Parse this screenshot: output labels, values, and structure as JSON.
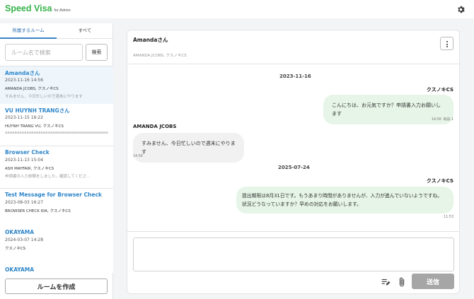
{
  "app": {
    "name": "Speed Visa",
    "subtitle": "for Admin"
  },
  "tabs": [
    {
      "label": "所属するルーム",
      "active": true
    },
    {
      "label": "すべて",
      "active": false
    }
  ],
  "search": {
    "placeholder": "ルーム名で検索",
    "value": "",
    "button_label": "検索"
  },
  "rooms": [
    {
      "title": "Amandaさん",
      "date": "2023-11-16 14:56",
      "members": "AMANDA JCOBS, クスノキCS",
      "preview": "すみません、今日忙しいので週末にやります"
    },
    {
      "title": "VU HUYNH TRANGさん",
      "date": "2023-11-15 16:22",
      "members": "HUYNH TRANG VU, クスノキCS",
      "preview": "aaaaaaaaaaaaaaaaaaaaaaaaaaaaaaaaaaaaaaaaaaaaaaaaaaaaa"
    },
    {
      "title": "Browser Check",
      "date": "2023-11-13 15:04",
      "members": "ASH MAYFAIR, クスノキCS",
      "preview": "申請書の入力依頼をしました。確認してくださ..."
    },
    {
      "title": "Test Message for Browser Check",
      "date": "2023-08-03 16:27",
      "members": "BROWSER CHECK IDA, クスノキCS",
      "preview": ""
    },
    {
      "title": "OKAYAMA",
      "date": "2024-03-07 14:28",
      "members": "クスノキCS",
      "preview": ""
    },
    {
      "title": "OKAYAMA",
      "date": "",
      "members": "",
      "preview": ""
    }
  ],
  "create_room_label": "ルームを作成",
  "chat": {
    "title": "Amandaさん",
    "members": "AMANDA JCOBS, クスノキCS",
    "date1": "2023-11-16",
    "msg1": {
      "sender": "クスノキCS",
      "text": "こんにちは、お元気ですか？申請書入力お願いします",
      "time": "14:56",
      "read": "既読 1"
    },
    "msg2": {
      "sender": "AMANDA JCOBS",
      "text": "すみません、今日忙しいので週末にやります",
      "time": "14:56"
    },
    "date2": "2025-07-24",
    "msg3": {
      "sender": "クスノキCS",
      "line1": "提出期限は8月31日です。もうあまり時間がありませんが、入力が進んでいないようですね。",
      "line2": "状況どうなっていますか？早めの対応をお願いします。",
      "time": "11:53"
    },
    "input_placeholder": "",
    "send_label": "送信"
  },
  "colors": {
    "brand": "#35b34a",
    "link": "#2f86c9",
    "my_bubble": "#e6f5e7",
    "their_bubble": "#f1f1f1",
    "send_disabled": "#a6a6a6"
  },
  "icons": {
    "settings": "gear-icon",
    "menu": "kebab-menu-icon",
    "template": "text-template-icon",
    "attach": "paperclip-icon"
  }
}
